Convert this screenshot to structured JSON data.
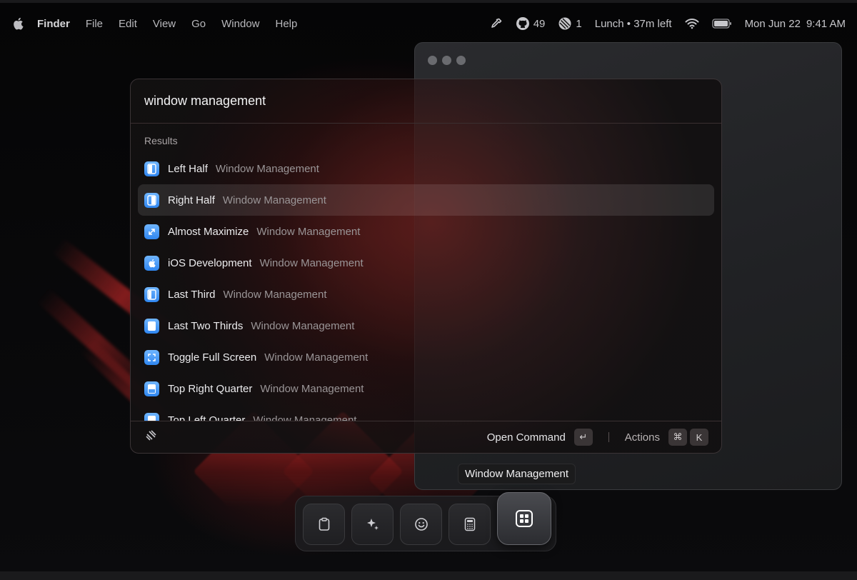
{
  "menubar": {
    "app": "Finder",
    "menus": [
      "File",
      "Edit",
      "View",
      "Go",
      "Window",
      "Help"
    ],
    "github_count": "49",
    "linear_count": "1",
    "event": "Lunch • 37m left",
    "date": "Mon Jun 22",
    "time": "9:41 AM"
  },
  "search": {
    "value": "window management"
  },
  "results_label": "Results",
  "results": [
    {
      "title": "Left Half",
      "subtitle": "Window Management",
      "icon": "left-half-icon"
    },
    {
      "title": "Right Half",
      "subtitle": "Window Management",
      "icon": "right-half-icon",
      "selected": true
    },
    {
      "title": "Almost Maximize",
      "subtitle": "Window Management",
      "icon": "almost-maximize-icon"
    },
    {
      "title": "iOS Development",
      "subtitle": "Window Management",
      "icon": "apple-icon"
    },
    {
      "title": "Last Third",
      "subtitle": "Window Management",
      "icon": "last-third-icon"
    },
    {
      "title": "Last Two Thirds",
      "subtitle": "Window Management",
      "icon": "last-two-thirds-icon"
    },
    {
      "title": "Toggle Full Screen",
      "subtitle": "Window Management",
      "icon": "toggle-full-screen-icon"
    },
    {
      "title": "Top Right Quarter",
      "subtitle": "Window Management",
      "icon": "top-right-quarter-icon"
    },
    {
      "title": "Top Left Quarter",
      "subtitle": "Window Management",
      "icon": "top-left-quarter-icon"
    }
  ],
  "footer": {
    "primary_action": "Open Command",
    "primary_key": "↵",
    "actions_label": "Actions",
    "actions_keys": [
      "⌘",
      "K"
    ]
  },
  "tooltip": "Window Management",
  "dock": [
    {
      "name": "clipboard-icon"
    },
    {
      "name": "ai-sparkle-icon"
    },
    {
      "name": "emoji-icon"
    },
    {
      "name": "calculator-icon"
    },
    {
      "name": "window-management-icon",
      "active": true
    }
  ],
  "colors": {
    "accent_blue": "#3b8ef0",
    "selection": "#3a3335"
  }
}
